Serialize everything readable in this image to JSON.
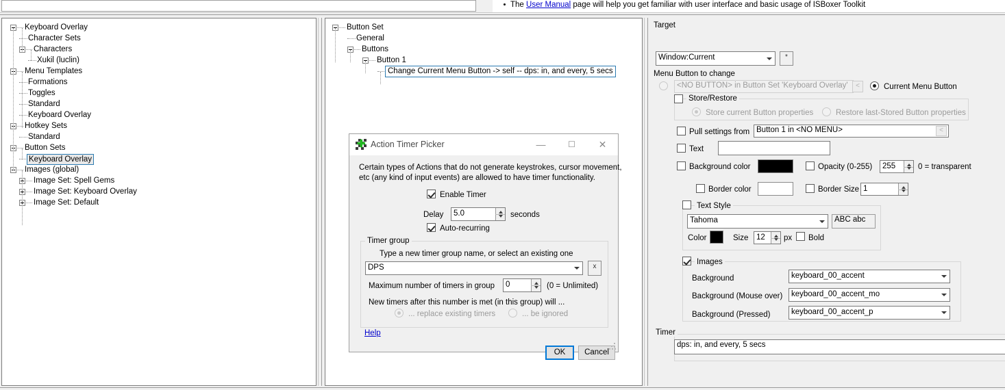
{
  "top_bar": {
    "bullet_prefix": "The ",
    "link_text": "User Manual",
    "bullet_suffix": " page will help you get familiar with user interface and basic usage of ISBoxer Toolkit"
  },
  "left_tree": {
    "nodes": [
      {
        "label": "Keyboard Overlay",
        "depth": 0,
        "expander": "minus"
      },
      {
        "label": "Character Sets",
        "depth": 1,
        "expander": "none"
      },
      {
        "label": "Characters",
        "depth": 1,
        "expander": "minus"
      },
      {
        "label": "Xukil (luclin)",
        "depth": 2,
        "expander": "none"
      },
      {
        "label": "Menu Templates",
        "depth": 0,
        "expander": "minus"
      },
      {
        "label": "Formations",
        "depth": 1,
        "expander": "none"
      },
      {
        "label": "Toggles",
        "depth": 1,
        "expander": "none"
      },
      {
        "label": "Standard",
        "depth": 1,
        "expander": "none"
      },
      {
        "label": "Keyboard Overlay",
        "depth": 1,
        "expander": "none"
      },
      {
        "label": "Hotkey Sets",
        "depth": 0,
        "expander": "minus"
      },
      {
        "label": "Standard",
        "depth": 1,
        "expander": "none"
      },
      {
        "label": "Button Sets",
        "depth": 0,
        "expander": "minus"
      },
      {
        "label": "Keyboard Overlay",
        "depth": 1,
        "expander": "none",
        "selected": true
      },
      {
        "label": "Images (global)",
        "depth": 0,
        "expander": "minus"
      },
      {
        "label": "Image Set: Spell Gems",
        "depth": 1,
        "expander": "plus"
      },
      {
        "label": "Image Set: Keyboard Overlay",
        "depth": 1,
        "expander": "plus"
      },
      {
        "label": "Image Set: Default",
        "depth": 1,
        "expander": "plus"
      }
    ]
  },
  "mid_tree": {
    "nodes": [
      {
        "label": "Button Set",
        "depth": 0,
        "expander": "minus"
      },
      {
        "label": "General",
        "depth": 1,
        "expander": "none"
      },
      {
        "label": "Buttons",
        "depth": 1,
        "expander": "minus"
      },
      {
        "label": "Button 1",
        "depth": 2,
        "expander": "minus"
      },
      {
        "label": "Change Current Menu Button -> self -- dps: in, and every, 5 secs",
        "depth": 3,
        "expander": "none",
        "selected": true
      }
    ]
  },
  "right_panel": {
    "target_label": "Target",
    "target_value": "Window:Current",
    "target_star_button": "*",
    "menu_button_to_change_label": "Menu Button to change",
    "no_button_value": "<NO BUTTON> in Button Set 'Keyboard Overlay'",
    "no_button_picker": "<",
    "current_menu_button_label": "Current Menu Button",
    "store_restore_label": "Store/Restore",
    "store_current_label": "Store current Button properties",
    "restore_last_label": "Restore last-Stored Button properties",
    "pull_settings_label": "Pull settings from",
    "pull_settings_value": "Button 1 in <NO MENU>",
    "pull_settings_picker": "<",
    "text_label": "Text",
    "text_value": "",
    "background_color_label": "Background color",
    "background_color_value": "#000000",
    "opacity_label": "Opacity (0-255)",
    "opacity_value": "255",
    "opacity_hint": "0 = transparent",
    "border_color_label": "Border color",
    "border_color_value": "#ffffff",
    "border_size_label": "Border Size",
    "border_size_value": "1",
    "text_style_label": "Text Style",
    "font_value": "Tahoma",
    "font_preview": "ABC abc",
    "color_label": "Color",
    "text_color_value": "#000000",
    "size_label": "Size",
    "size_value": "12",
    "px_label": "px",
    "bold_label": "Bold",
    "images_label": "Images",
    "image_rows": [
      {
        "label": "Background",
        "value": "keyboard_00_accent"
      },
      {
        "label": "Background (Mouse over)",
        "value": "keyboard_00_accent_mo"
      },
      {
        "label": "Background (Pressed)",
        "value": "keyboard_00_accent_p"
      }
    ],
    "timer_label": "Timer",
    "timer_value": "dps: in, and every, 5 secs"
  },
  "dialog": {
    "title": "Action Timer Picker",
    "minimize": "—",
    "maximize": "☐",
    "close": "✕",
    "description_line1": "Certain types of Actions that do not generate keystrokes, cursor movement,",
    "description_line2": "etc (any kind of input events) are allowed to have timer functionality.",
    "enable_timer_label": "Enable Timer",
    "delay_label": "Delay",
    "delay_value": "5.0",
    "seconds_label": "seconds",
    "auto_recurring_label": "Auto-recurring",
    "timer_group_label": "Timer group",
    "timer_group_hint": "Type a new timer group name, or select an existing one",
    "timer_group_value": "DPS",
    "clear_button": "x",
    "max_timers_label": "Maximum number of timers in group",
    "max_timers_value": "0",
    "max_timers_hint": "(0 = Unlimited)",
    "new_timers_label": "New timers after this number is met (in this group) will ...",
    "replace_label": "... replace existing timers",
    "ignore_label": "... be ignored",
    "help_link": "Help",
    "ok_button": "OK",
    "cancel_button": "Cancel"
  }
}
